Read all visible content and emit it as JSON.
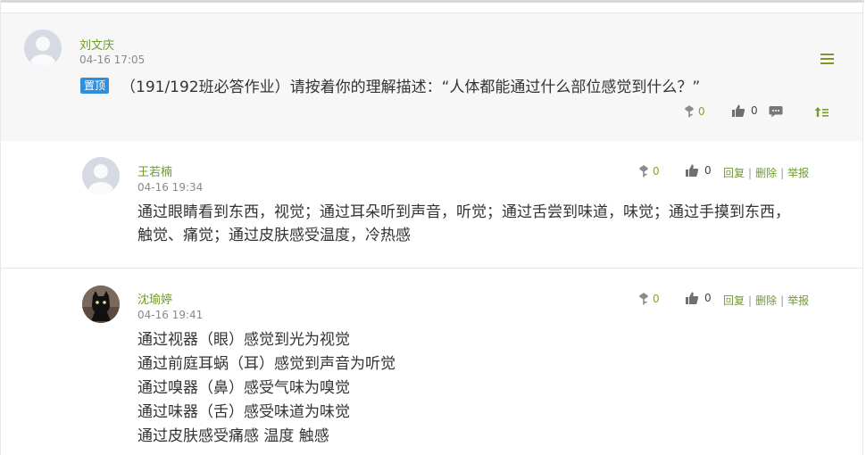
{
  "post": {
    "author": "刘文庆",
    "time": "04-16 17:05",
    "badge": "置顶",
    "title": "（191/192班必答作业）请按着你的理解描述：“人体都能通过什么部位感觉到什么？”",
    "flower_count": "0",
    "like_count": "0"
  },
  "comments": [
    {
      "author": "王若楠",
      "time": "04-16 19:34",
      "flower_count": "0",
      "like_count": "0",
      "lines": [
        "通过眼睛看到东西，视觉；通过耳朵听到声音，听觉；通过舌尝到味道，味觉；通过手摸到东西，",
        "触觉、痛觉；通过皮肤感受温度，冷热感"
      ]
    },
    {
      "author": "沈瑜婷",
      "time": "04-16 19:41",
      "flower_count": "0",
      "like_count": "0",
      "lines": [
        "通过视器（眼）感觉到光为视觉",
        "通过前庭耳蜗（耳）感觉到声音为听觉",
        "通过嗅器（鼻）感受气味为嗅觉",
        "通过味器（舌）感受味道为味觉",
        "通过皮肤感受痛感 温度 触感"
      ]
    }
  ],
  "actions": {
    "reply": "回复",
    "delete": "删除",
    "report": "举报",
    "separator": "|"
  },
  "colors": {
    "author": "#6f9a2c",
    "badge": "#2f8fdc",
    "accent": "#7a9a2a"
  },
  "icons": [
    "flower-icon",
    "thumbs-up-icon",
    "comment-icon",
    "top-arrow-icon",
    "menu-icon"
  ]
}
